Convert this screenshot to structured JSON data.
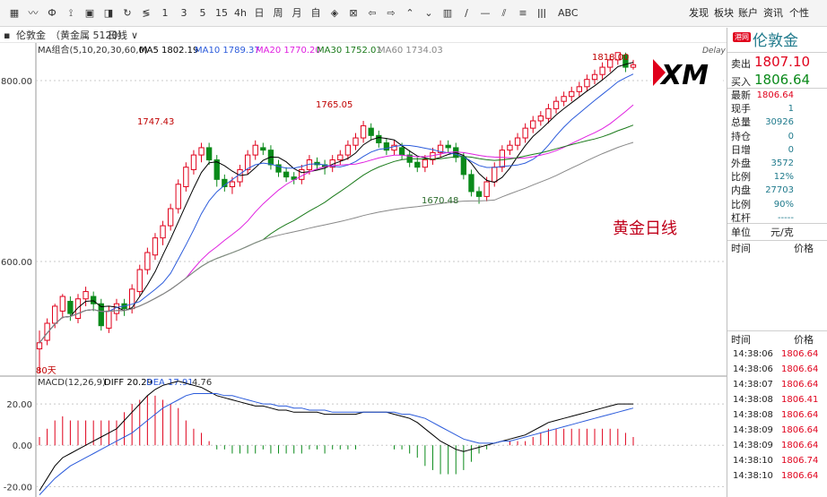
{
  "toolbar": {
    "tools": [
      {
        "label": "▦",
        "icon": "grid-icon"
      },
      {
        "label": "〰",
        "icon": "line-chart-icon"
      },
      {
        "label": "Ф",
        "icon": "candle-icon"
      },
      {
        "label": "⟟",
        "icon": "crosshair-icon"
      },
      {
        "label": "▣",
        "icon": "layout-icon"
      },
      {
        "label": "◨",
        "icon": "save-icon"
      },
      {
        "label": "↻",
        "icon": "refresh-icon"
      },
      {
        "label": "≶",
        "icon": "compare-icon"
      },
      {
        "label": "1",
        "icon": ""
      },
      {
        "label": "3",
        "icon": ""
      },
      {
        "label": "5",
        "icon": ""
      },
      {
        "label": "15",
        "icon": ""
      },
      {
        "label": "4h",
        "icon": ""
      },
      {
        "label": "日",
        "icon": ""
      },
      {
        "label": "周",
        "icon": ""
      },
      {
        "label": "月",
        "icon": ""
      },
      {
        "label": "自",
        "icon": ""
      },
      {
        "label": "◈",
        "icon": "zoom-icon"
      },
      {
        "label": "⊠",
        "icon": "reset-icon"
      },
      {
        "label": "⇦",
        "icon": "pan-left-icon"
      },
      {
        "label": "⇨",
        "icon": "pan-right-icon"
      },
      {
        "label": "⌃",
        "icon": "zoom-in-icon"
      },
      {
        "label": "⌄",
        "icon": "zoom-out-icon"
      },
      {
        "label": "▥",
        "icon": "panel-icon"
      },
      {
        "label": "∕",
        "icon": "draw-line-icon"
      },
      {
        "label": "—",
        "icon": "hline-icon"
      },
      {
        "label": "⫽",
        "icon": "channel-icon"
      },
      {
        "label": "≡",
        "icon": "fib-icon"
      },
      {
        "label": "ǀǀǀ",
        "icon": "bars-icon"
      },
      {
        "label": "ABC",
        "icon": "text-icon"
      }
    ],
    "menus": [
      "发现",
      "板块",
      "账户",
      "资讯",
      "个性"
    ]
  },
  "instrument": {
    "marker": "▪",
    "name": "伦敦金",
    "code": "（黄金属 5120）",
    "period": "日线",
    "chevron": "∨"
  },
  "chart": {
    "ma_header": {
      "title": "MA组合(5,10,20,30,60,0)",
      "items": [
        {
          "label": "MA5 1802.19",
          "color": "#000000"
        },
        {
          "label": "MA10 1789.37",
          "color": "#2b5bdb"
        },
        {
          "label": "MA20 1770.20",
          "color": "#e020e0"
        },
        {
          "label": "MA30 1752.01",
          "color": "#1a7a1a"
        },
        {
          "label": "MA60 1734.03",
          "color": "#888888"
        }
      ]
    },
    "delay_label": "Delay",
    "price_axis": [
      "800.00",
      "600.00"
    ],
    "annotations": {
      "high1": "1747.43",
      "high2": "1765.05",
      "low": "1670.48",
      "recent_high": "1818.00",
      "days": "80天"
    },
    "watermark": "黄金日线",
    "logo": "XM",
    "macd_header": {
      "title": "MACD(12,26,9)",
      "diff": "DIFF 20.29",
      "dea": "DEA 17.91",
      "macd": "4.76"
    },
    "macd_axis": [
      "20.00",
      "0.00",
      "-20.00"
    ]
  },
  "colors": {
    "up": "#e0001b",
    "down": "#0a8a1a",
    "ma5": "#000000",
    "ma10": "#2b5bdb",
    "ma20": "#e020e0",
    "ma30": "#1a7a1a",
    "ma60": "#888888",
    "diff": "#000000",
    "dea": "#2b5bdb"
  },
  "quote": {
    "badge": "港网",
    "name": "伦敦金",
    "sell_label": "卖出",
    "sell_price": "1807.10",
    "buy_label": "买入",
    "buy_price": "1806.64",
    "stats": [
      {
        "k": "最新",
        "v": "1806.64",
        "c": "red"
      },
      {
        "k": "现手",
        "v": "1",
        "c": "teal"
      },
      {
        "k": "总量",
        "v": "30926",
        "c": "teal"
      },
      {
        "k": "持仓",
        "v": "0",
        "c": "teal"
      },
      {
        "k": "日增",
        "v": "0",
        "c": "teal"
      },
      {
        "k": "外盘",
        "v": "3572",
        "c": "teal"
      },
      {
        "k": "比例",
        "v": "12%",
        "c": "teal"
      },
      {
        "k": "内盘",
        "v": "27703",
        "c": "teal"
      },
      {
        "k": "比例",
        "v": "90%",
        "c": "teal"
      },
      {
        "k": "杠杆",
        "v": "-----",
        "c": "teal"
      }
    ],
    "unit_label": "单位",
    "unit_value": "元/克",
    "time_header": "时间",
    "price_header": "价格",
    "ticks": [
      {
        "t": "14:38:06",
        "p": "1806.64"
      },
      {
        "t": "14:38:06",
        "p": "1806.64"
      },
      {
        "t": "14:38:07",
        "p": "1806.64"
      },
      {
        "t": "14:38:08",
        "p": "1806.41"
      },
      {
        "t": "14:38:08",
        "p": "1806.64"
      },
      {
        "t": "14:38:09",
        "p": "1806.64"
      },
      {
        "t": "14:38:09",
        "p": "1806.64"
      },
      {
        "t": "14:38:10",
        "p": "1806.74"
      },
      {
        "t": "14:38:10",
        "p": "1806.64"
      }
    ]
  },
  "chart_data": {
    "type": "candlestick",
    "title": "",
    "xlabel": "",
    "ylabel": "",
    "ylim": [
      560,
      820
    ],
    "candles": [
      [
        575,
        580,
        555,
        590
      ],
      [
        582,
        596,
        578,
        600
      ],
      [
        596,
        610,
        592,
        612
      ],
      [
        606,
        618,
        600,
        620
      ],
      [
        614,
        604,
        598,
        618
      ],
      [
        600,
        616,
        596,
        620
      ],
      [
        616,
        622,
        610,
        626
      ],
      [
        618,
        612,
        606,
        622
      ],
      [
        612,
        594,
        590,
        616
      ],
      [
        592,
        606,
        588,
        610
      ],
      [
        604,
        612,
        598,
        616
      ],
      [
        612,
        608,
        602,
        616
      ],
      [
        608,
        624,
        604,
        628
      ],
      [
        622,
        640,
        618,
        644
      ],
      [
        640,
        654,
        636,
        658
      ],
      [
        652,
        666,
        648,
        670
      ],
      [
        666,
        676,
        660,
        680
      ],
      [
        676,
        690,
        672,
        694
      ],
      [
        690,
        710,
        686,
        714
      ],
      [
        708,
        724,
        704,
        728
      ],
      [
        722,
        734,
        718,
        738
      ],
      [
        734,
        740,
        728,
        744
      ],
      [
        740,
        730,
        726,
        744
      ],
      [
        730,
        714,
        708,
        734
      ],
      [
        714,
        708,
        704,
        718
      ],
      [
        708,
        712,
        702,
        716
      ],
      [
        712,
        722,
        708,
        726
      ],
      [
        722,
        734,
        718,
        738
      ],
      [
        734,
        742,
        730,
        746
      ],
      [
        740,
        738,
        734,
        744
      ],
      [
        738,
        726,
        722,
        742
      ],
      [
        726,
        720,
        716,
        730
      ],
      [
        720,
        716,
        712,
        724
      ],
      [
        716,
        714,
        710,
        720
      ],
      [
        714,
        722,
        710,
        726
      ],
      [
        722,
        730,
        718,
        734
      ],
      [
        728,
        726,
        722,
        732
      ],
      [
        726,
        724,
        718,
        730
      ],
      [
        724,
        730,
        720,
        734
      ],
      [
        730,
        734,
        726,
        738
      ],
      [
        734,
        742,
        730,
        746
      ],
      [
        742,
        748,
        738,
        752
      ],
      [
        748,
        758,
        744,
        762
      ],
      [
        756,
        750,
        746,
        760
      ],
      [
        750,
        744,
        740,
        754
      ],
      [
        744,
        738,
        734,
        748
      ],
      [
        738,
        742,
        734,
        746
      ],
      [
        740,
        734,
        730,
        744
      ],
      [
        734,
        728,
        724,
        738
      ],
      [
        728,
        724,
        720,
        732
      ],
      [
        724,
        730,
        720,
        734
      ],
      [
        730,
        736,
        726,
        740
      ],
      [
        736,
        742,
        732,
        746
      ],
      [
        742,
        740,
        736,
        746
      ],
      [
        740,
        732,
        728,
        744
      ],
      [
        732,
        718,
        714,
        736
      ],
      [
        718,
        704,
        700,
        722
      ],
      [
        704,
        700,
        694,
        708
      ],
      [
        700,
        712,
        696,
        716
      ],
      [
        712,
        724,
        708,
        728
      ],
      [
        724,
        738,
        720,
        742
      ],
      [
        738,
        742,
        734,
        746
      ],
      [
        742,
        748,
        738,
        752
      ],
      [
        748,
        756,
        744,
        760
      ],
      [
        756,
        762,
        752,
        766
      ],
      [
        762,
        766,
        758,
        770
      ],
      [
        764,
        772,
        760,
        776
      ],
      [
        772,
        778,
        768,
        782
      ],
      [
        778,
        782,
        774,
        786
      ],
      [
        782,
        786,
        778,
        790
      ],
      [
        786,
        790,
        782,
        794
      ],
      [
        790,
        796,
        786,
        800
      ],
      [
        796,
        800,
        792,
        804
      ],
      [
        800,
        806,
        796,
        810
      ],
      [
        806,
        812,
        802,
        816
      ],
      [
        812,
        818,
        808,
        818
      ],
      [
        816,
        806,
        802,
        818
      ],
      [
        806,
        808,
        804,
        812
      ]
    ],
    "macd": {
      "diff": [
        -22,
        -16,
        -10,
        -6,
        -4,
        -2,
        0,
        2,
        4,
        6,
        8,
        12,
        16,
        20,
        24,
        27,
        29,
        30,
        31,
        30,
        29,
        28,
        26,
        24,
        23,
        22,
        21,
        20,
        19,
        19,
        18,
        17,
        17,
        16,
        16,
        16,
        16,
        15,
        15,
        15,
        15,
        15,
        16,
        16,
        16,
        16,
        15,
        14,
        13,
        11,
        8,
        5,
        2,
        0,
        -2,
        -3,
        -2,
        -1,
        0,
        1,
        2,
        3,
        4,
        5,
        7,
        9,
        11,
        12,
        13,
        14,
        15,
        16,
        17,
        18,
        19,
        20,
        20,
        20
      ],
      "dea": [
        -24,
        -20,
        -16,
        -13,
        -10,
        -8,
        -6,
        -4,
        -2,
        0,
        2,
        4,
        6,
        9,
        12,
        15,
        18,
        20,
        22,
        24,
        25,
        25,
        25,
        25,
        24,
        24,
        23,
        22,
        21,
        20,
        20,
        19,
        19,
        18,
        18,
        17,
        17,
        17,
        16,
        16,
        16,
        16,
        16,
        16,
        16,
        16,
        16,
        15,
        15,
        14,
        13,
        11,
        9,
        7,
        5,
        3,
        2,
        1,
        1,
        1,
        2,
        2,
        3,
        4,
        5,
        6,
        7,
        8,
        9,
        10,
        11,
        12,
        13,
        14,
        15,
        16,
        17,
        18
      ]
    }
  }
}
